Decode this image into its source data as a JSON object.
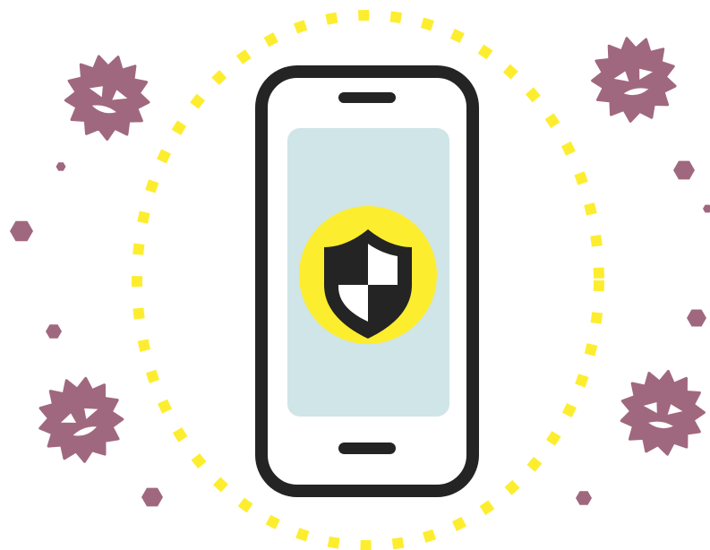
{
  "illustration": {
    "subject": "",
    "colors": {
      "background": "#ffffff",
      "phone_outline": "#242424",
      "phone_body": "#ffffff",
      "screen": "#cfe5e8",
      "shield_badge": "#fded2f",
      "shield_dark": "#242424",
      "shield_light": "#ffffff",
      "protective_ring": "#fded2f",
      "virus": "#a0687e",
      "virus_face": "#ffffff"
    },
    "icons": [
      "smartphone-icon",
      "shield-icon",
      "virus-icon",
      "protective-ring"
    ]
  }
}
